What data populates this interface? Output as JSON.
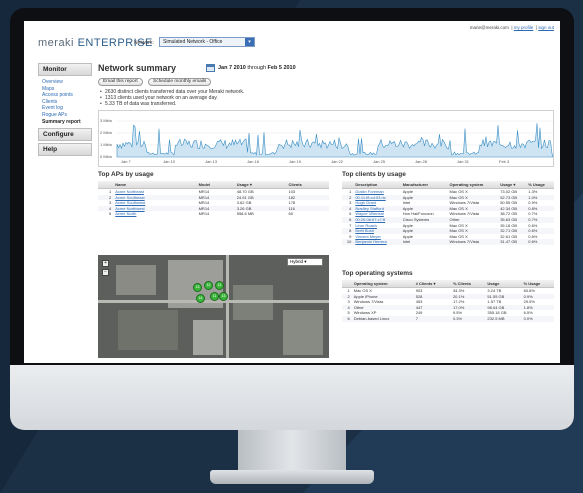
{
  "app": {
    "logo_main": "meraki",
    "logo_sub": "ENTERPRISE",
    "network_label": "Network:",
    "network_value": "Simulated Network - Office",
    "user_email": "marie@meraki.com",
    "my_profile": "my profile",
    "sign_out": "sign out"
  },
  "sidebar": {
    "monitor_label": "Monitor",
    "monitor_items": [
      "Overview",
      "Maps",
      "Access points",
      "Clients",
      "Event log",
      "Rogue APs",
      "Summary report"
    ],
    "configure_label": "Configure",
    "help_label": "Help"
  },
  "page": {
    "title": "Network summary",
    "date_from": "Jan 7 2010",
    "date_through": "through",
    "date_to": "Feb 5 2010",
    "email_button": "Email this report",
    "schedule_button": "Schedule monthly emails",
    "summary_lines": [
      "2630 distinct clients transferred data over your Meraki network.",
      "1313 clients used your network on an average day.",
      "5.33 TB of data was transferred."
    ]
  },
  "graph": {
    "y_labels": [
      "3 Mb/s",
      "2 Mb/s",
      "1 Mb/s",
      "0 Mb/s"
    ],
    "x_labels": [
      "Jan 7",
      "Jan 10",
      "Jan 13",
      "Jan 16",
      "Jan 19",
      "Jan 22",
      "Jan 25",
      "Jan 28",
      "Jan 31",
      "Feb 3"
    ],
    "line_color": "#3a8fc4"
  },
  "top_aps": {
    "title": "Top APs by usage",
    "headers": [
      "",
      "Name",
      "Model",
      "Usage ▾",
      "Clients"
    ],
    "rows": [
      [
        "1",
        "Acme Northeast",
        "MR14",
        "48.70 GB",
        "103"
      ],
      [
        "2",
        "Acme Southeast",
        "MR14",
        "24.91 GB",
        "182"
      ],
      [
        "3",
        "Acme Southwest",
        "MR14",
        "3.62 GB",
        "178"
      ],
      [
        "4",
        "Acme Northwest",
        "MR14",
        "3.26 GB",
        "116"
      ],
      [
        "5",
        "Acme North",
        "MR14",
        "558.6 MB",
        "60"
      ]
    ]
  },
  "map": {
    "type_select": "Hybrid",
    "pins": [
      "13",
      "12",
      "11",
      "14",
      "11",
      "13"
    ]
  },
  "top_clients": {
    "title": "Top clients by usage",
    "headers": [
      "",
      "Description",
      "Manufacturer",
      "Operating system",
      "Usage ▾",
      "% Usage"
    ],
    "rows": [
      [
        "1",
        "Dustin Foreman",
        "Apple",
        "Mac OS X",
        "73.02 GB",
        "1.3%"
      ],
      [
        "2",
        "00:11:f8:cd:03:dc",
        "Apple",
        "Mac OS X",
        "52.73 GB",
        "1.0%"
      ],
      [
        "3",
        "Hugh Grant",
        "Intel",
        "Windows 7/Vista",
        "50.55 GB",
        "0.9%"
      ],
      [
        "4",
        "Bradley Stafford",
        "Apple",
        "Mac OS X",
        "42.34 GB",
        "0.8%"
      ],
      [
        "5",
        "Wayne Villeneal",
        "Hon Hai/Foxconn",
        "Windows 7/Vista",
        "38.72 GB",
        "0.7%"
      ],
      [
        "6",
        "00:26:08:67:c7:ff",
        "Cisco Systems",
        "Other",
        "35.63 GB",
        "0.7%"
      ],
      [
        "7",
        "Leon Roach",
        "Apple",
        "Mac OS X",
        "35.18 GB",
        "0.6%"
      ],
      [
        "8",
        "Brett Bush",
        "Apple",
        "Mac OS X",
        "32.71 GB",
        "0.6%"
      ],
      [
        "9",
        "Vincent Meyer",
        "Apple",
        "Mac OS X",
        "32.61 GB",
        "0.6%"
      ],
      [
        "10",
        "Benjamin Herrera",
        "Intel",
        "Windows 7/Vista",
        "31.47 GB",
        "0.6%"
      ]
    ]
  },
  "top_os": {
    "title": "Top operating systems",
    "headers": [
      "",
      "Operating system",
      "# Clients ▾",
      "% Clients",
      "Usage",
      "% Usage"
    ],
    "rows": [
      [
        "1",
        "Mac OS X",
        "903",
        "34.3%",
        "3.24 TB",
        "60.8%"
      ],
      [
        "2",
        "Apple iPhone",
        "528",
        "20.1%",
        "51.55 GB",
        "0.9%"
      ],
      [
        "3",
        "Windows 7/Vista",
        "453",
        "17.2%",
        "1.57 TB",
        "29.5%"
      ],
      [
        "4",
        "Other",
        "447",
        "17.0%",
        "98.04 GB",
        "1.8%"
      ],
      [
        "5",
        "Windows XP",
        "249",
        "9.5%",
        "355.18 GB",
        "6.5%"
      ],
      [
        "6",
        "Debian-based Linux",
        "7",
        "0.3%",
        "232.5 MB",
        "0.0%"
      ]
    ]
  }
}
